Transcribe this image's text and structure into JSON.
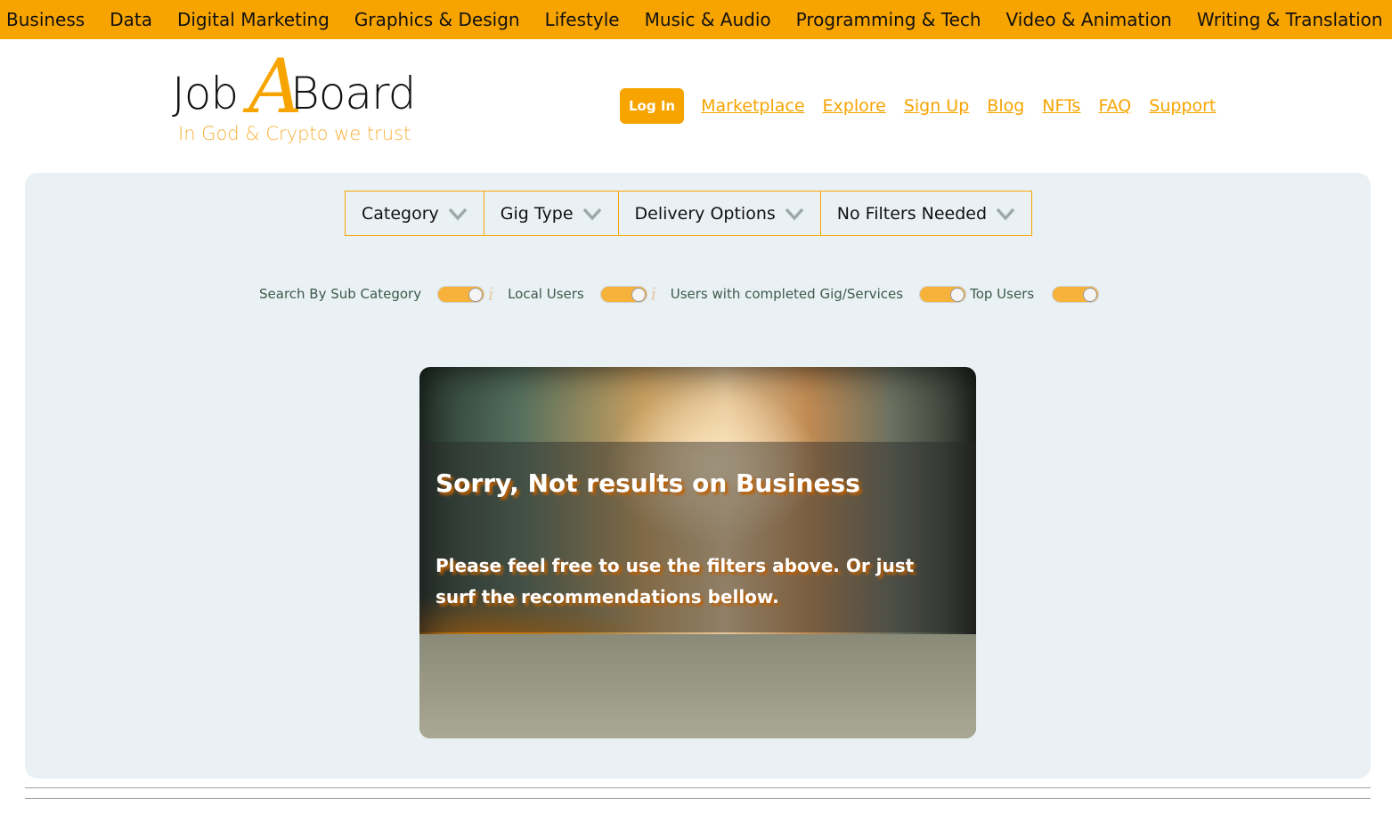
{
  "top_categories": [
    "Business",
    "Data",
    "Digital Marketing",
    "Graphics & Design",
    "Lifestyle",
    "Music & Audio",
    "Programming & Tech",
    "Video & Animation",
    "Writing & Translation"
  ],
  "logo": {
    "job": "Job",
    "a": "A",
    "board": "Board",
    "tagline": "In God & Crypto we trust"
  },
  "nav": {
    "login": "Log In",
    "links": [
      "Marketplace",
      "Explore",
      "Sign Up",
      "Blog",
      "NFTs",
      "FAQ",
      "Support"
    ]
  },
  "filters": [
    "Category",
    "Gig Type",
    "Delivery Options",
    "No Filters Needed"
  ],
  "toggles": {
    "sub_category": "Search By Sub Category",
    "local_users": "Local Users",
    "completed": "Users with completed Gig/Services",
    "top_users": "Top Users"
  },
  "card": {
    "title": "Sorry, Not results on Business",
    "message": "Please feel free to use the filters above. Or just surf the recommendations bellow."
  },
  "colors": {
    "accent": "#f7a400",
    "panel": "#eaf1f4"
  }
}
